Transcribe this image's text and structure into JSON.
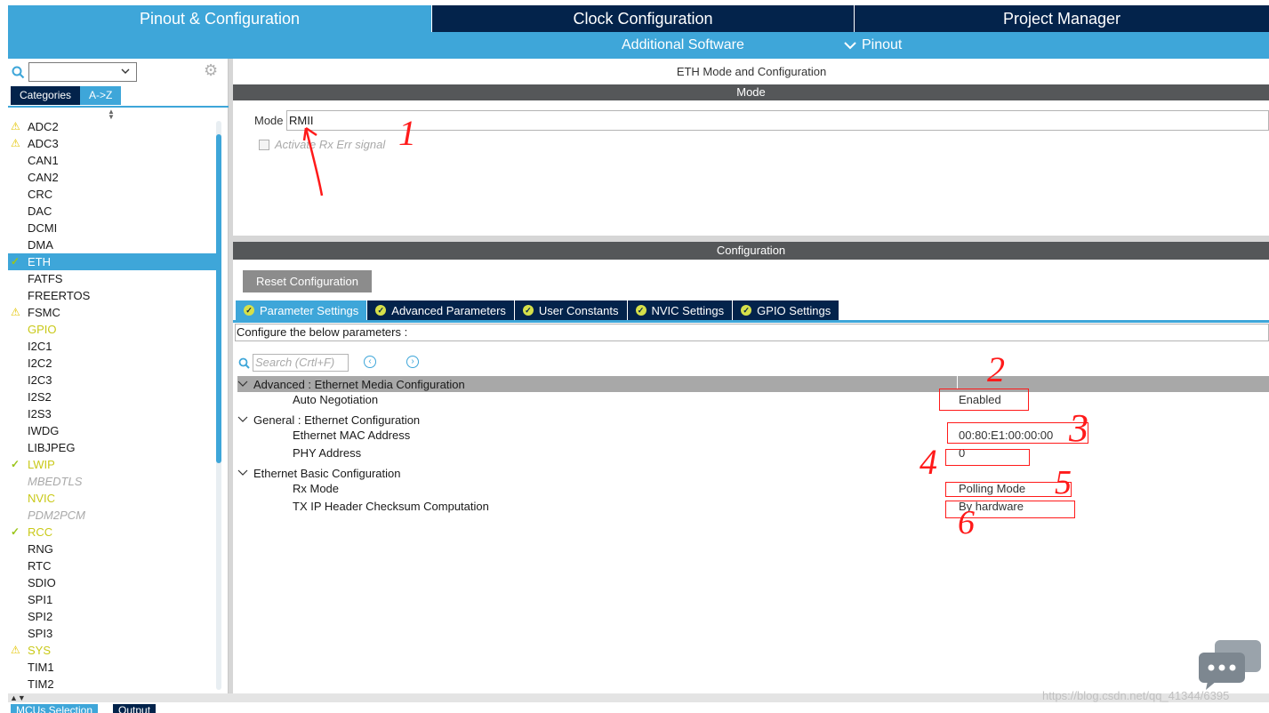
{
  "top_tabs": [
    {
      "label": "Pinout & Configuration",
      "active": true
    },
    {
      "label": "Clock Configuration",
      "active": false
    },
    {
      "label": "Project Manager",
      "active": false
    }
  ],
  "subbar": {
    "additional_software": "Additional Software",
    "pinout": "Pinout"
  },
  "left": {
    "category_tabs": [
      "Categories",
      "A->Z"
    ],
    "peripherals": [
      {
        "label": "ADC2",
        "state": "warn"
      },
      {
        "label": "ADC3",
        "state": "warn"
      },
      {
        "label": "CAN1",
        "state": "none"
      },
      {
        "label": "CAN2",
        "state": "none"
      },
      {
        "label": "CRC",
        "state": "none"
      },
      {
        "label": "DAC",
        "state": "none"
      },
      {
        "label": "DCMI",
        "state": "none"
      },
      {
        "label": "DMA",
        "state": "none"
      },
      {
        "label": "ETH",
        "state": "selected"
      },
      {
        "label": "FATFS",
        "state": "none"
      },
      {
        "label": "FREERTOS",
        "state": "none"
      },
      {
        "label": "FSMC",
        "state": "warn"
      },
      {
        "label": "GPIO",
        "state": "ok"
      },
      {
        "label": "I2C1",
        "state": "none"
      },
      {
        "label": "I2C2",
        "state": "none"
      },
      {
        "label": "I2C3",
        "state": "none"
      },
      {
        "label": "I2S2",
        "state": "none"
      },
      {
        "label": "I2S3",
        "state": "none"
      },
      {
        "label": "IWDG",
        "state": "none"
      },
      {
        "label": "LIBJPEG",
        "state": "none"
      },
      {
        "label": "LWIP",
        "state": "okcheck"
      },
      {
        "label": "MBEDTLS",
        "state": "disabled"
      },
      {
        "label": "NVIC",
        "state": "ok"
      },
      {
        "label": "PDM2PCM",
        "state": "disabled"
      },
      {
        "label": "RCC",
        "state": "okcheck"
      },
      {
        "label": "RNG",
        "state": "none"
      },
      {
        "label": "RTC",
        "state": "none"
      },
      {
        "label": "SDIO",
        "state": "none"
      },
      {
        "label": "SPI1",
        "state": "none"
      },
      {
        "label": "SPI2",
        "state": "none"
      },
      {
        "label": "SPI3",
        "state": "none"
      },
      {
        "label": "SYS",
        "state": "warncolor"
      },
      {
        "label": "TIM1",
        "state": "none"
      },
      {
        "label": "TIM2",
        "state": "none"
      }
    ]
  },
  "right": {
    "title": "ETH Mode and Configuration",
    "mode_header": "Mode",
    "mode_label": "Mode",
    "mode_value": "RMII",
    "rx_err_label": "Activate Rx Err signal",
    "config_header": "Configuration",
    "reset_button": "Reset Configuration",
    "param_tabs": [
      "Parameter Settings",
      "Advanced Parameters",
      "User Constants",
      "NVIC Settings",
      "GPIO Settings"
    ],
    "configure_text": "Configure the below parameters :",
    "search_placeholder": "Search (Crtl+F)",
    "groups": [
      {
        "title": "Advanced : Ethernet Media Configuration",
        "params": [
          {
            "name": "Auto Negotiation",
            "value": "Enabled"
          }
        ]
      },
      {
        "title": "General : Ethernet Configuration",
        "params": [
          {
            "name": "Ethernet MAC Address",
            "value": "00:80:E1:00:00:00"
          },
          {
            "name": "PHY Address",
            "value": "0"
          }
        ]
      },
      {
        "title": "Ethernet Basic Configuration",
        "params": [
          {
            "name": "Rx Mode",
            "value": "Polling Mode"
          },
          {
            "name": "TX IP Header Checksum Computation",
            "value": "By hardware"
          }
        ]
      }
    ],
    "annotations": [
      "1",
      "2",
      "3",
      "4",
      "5",
      "6"
    ]
  },
  "bottom": {
    "tabs": [
      "MCUs Selection",
      "Output"
    ],
    "watermark": "https://blog.csdn.net/qq_41344/6395"
  },
  "colors": {
    "accent": "#3ea6d9",
    "dark": "#03234b",
    "ok": "#c9c918",
    "annotation": "#ff1a1a"
  }
}
